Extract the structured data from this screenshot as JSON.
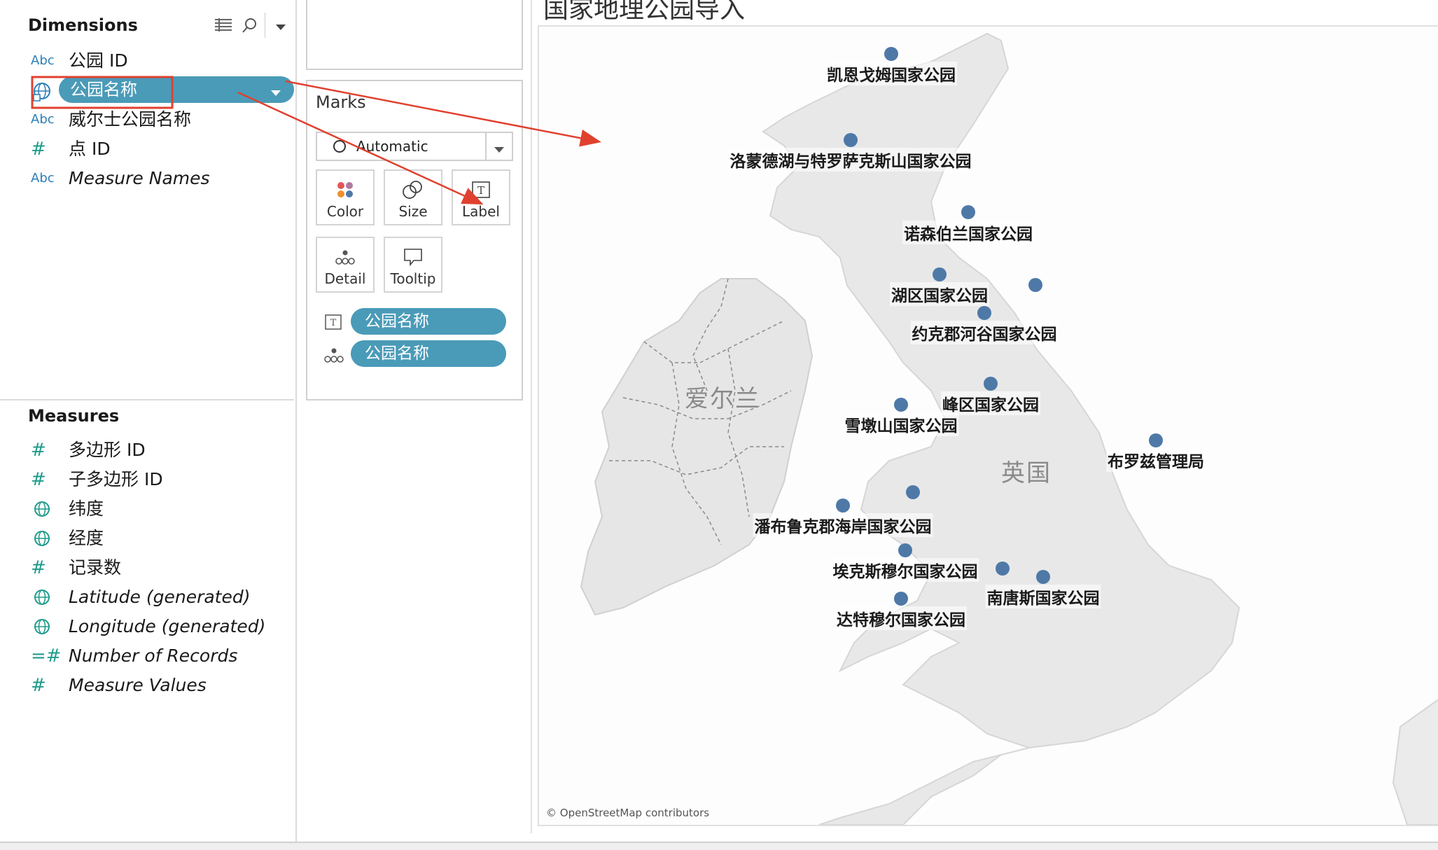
{
  "data_pane": {
    "dimensions_title": "Dimensions",
    "dimensions": [
      {
        "type": "Abc",
        "label": "公园 ID",
        "italic": false
      },
      {
        "type": "geo",
        "label": "公园名称",
        "italic": false,
        "selected": true
      },
      {
        "type": "Abc",
        "label": "威尔士公园名称",
        "italic": false
      },
      {
        "type": "#",
        "label": "点 ID",
        "italic": false
      },
      {
        "type": "Abc",
        "label": "Measure Names",
        "italic": true
      }
    ],
    "measures_title": "Measures",
    "measures": [
      {
        "type": "#",
        "label": "多边形 ID",
        "italic": false
      },
      {
        "type": "#",
        "label": "子多边形 ID",
        "italic": false
      },
      {
        "type": "geo",
        "label": "纬度",
        "italic": false
      },
      {
        "type": "geo",
        "label": "经度",
        "italic": false
      },
      {
        "type": "#",
        "label": "记录数",
        "italic": false
      },
      {
        "type": "geo",
        "label": "Latitude (generated)",
        "italic": true
      },
      {
        "type": "geo",
        "label": "Longitude (generated)",
        "italic": true
      },
      {
        "type": "=#",
        "label": "Number of Records",
        "italic": true
      },
      {
        "type": "#",
        "label": "Measure Values",
        "italic": true
      }
    ]
  },
  "marks": {
    "title": "Marks",
    "mark_type": "Automatic",
    "buttons": [
      "Color",
      "Size",
      "Label",
      "Detail",
      "Tooltip"
    ],
    "pills": [
      {
        "icon": "label-icon",
        "label": "公园名称"
      },
      {
        "icon": "detail-icon",
        "label": "公园名称"
      }
    ]
  },
  "viz": {
    "title": "国家地理公园导入",
    "attribution": "© OpenStreetMap contributors",
    "country_labels": [
      "爱尔兰",
      "英国"
    ],
    "parks": [
      "凯恩戈姆国家公园",
      "洛蒙德湖与特罗萨克斯山国家公园",
      "诺森伯兰国家公园",
      "湖区国家公园",
      "约克郡河谷国家公园",
      "峰区国家公园",
      "雪墩山国家公园",
      "布罗兹管理局",
      "潘布鲁克郡海岸国家公园",
      "埃克斯穆尔国家公园",
      "南唐斯国家公园",
      "达特穆尔国家公园"
    ]
  },
  "colors": {
    "pill": "#4a9bb8",
    "dot": "#4e79a7",
    "annotation": "#e0412f",
    "field_icon": "#1e9b8a"
  }
}
